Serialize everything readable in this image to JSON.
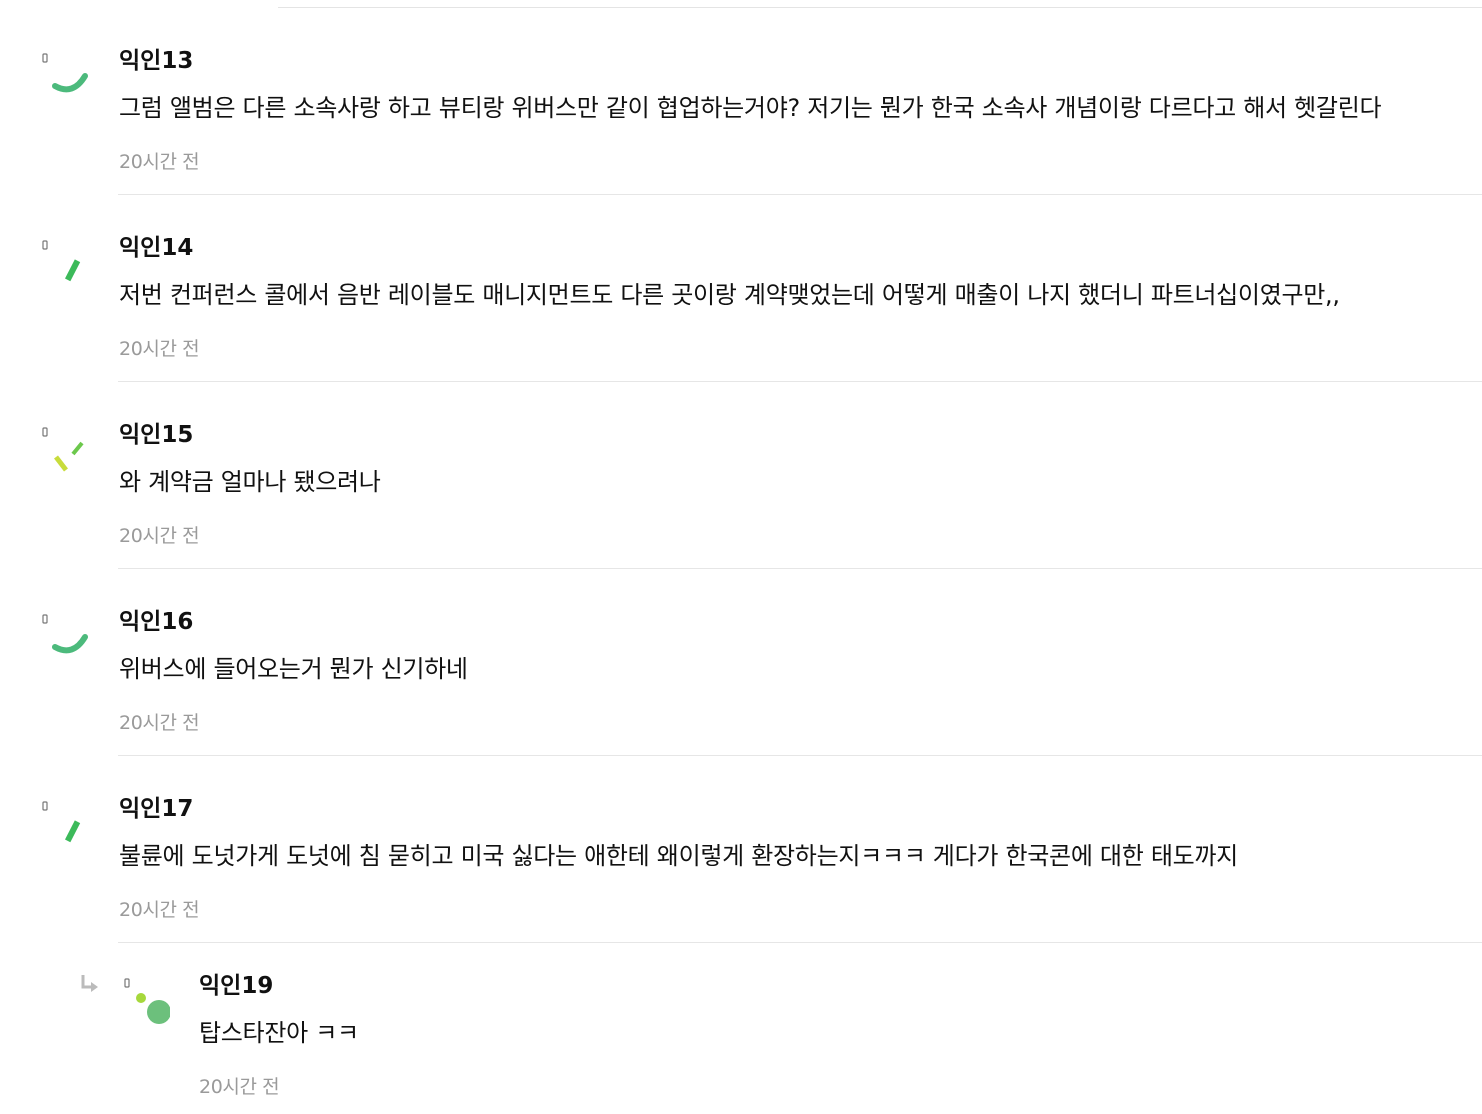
{
  "comments": [
    {
      "author": "익인13",
      "body": "그럼 앨범은 다른 소속사랑 하고 뷰티랑 위버스만 같이 협업하는거야? 저기는 뭔가 한국 소속사 개념이랑 다르다고 해서 헷갈린다",
      "time": "20시간 전",
      "avatar_icon": "arc-avatar-icon",
      "avatar_color": "#4cba7c"
    },
    {
      "author": "익인14",
      "body": "저번 컨퍼런스 콜에서 음반 레이블도 매니지먼트도 다른 곳이랑 계약맺었는데 어떻게 매출이 나지 했더니 파트너십이였구만,,",
      "time": "20시간 전",
      "avatar_icon": "bar-avatar-icon",
      "avatar_color": "#3cba5a"
    },
    {
      "author": "익인15",
      "body": "와 계약금 얼마나 됐으려나",
      "time": "20시간 전",
      "avatar_icon": "dashes-avatar-icon",
      "avatar_color": "#c8dc3c"
    },
    {
      "author": "익인16",
      "body": "위버스에 들어오는거 뭔가 신기하네",
      "time": "20시간 전",
      "avatar_icon": "arc-avatar-icon",
      "avatar_color": "#4cba7c"
    },
    {
      "author": "익인17",
      "body": "불륜에 도넛가게 도넛에 침 묻히고 미국 싫다는 애한테 왜이렇게 환장하는지ㅋㅋㅋ 게다가 한국콘에 대한 태도까지",
      "time": "20시간 전",
      "avatar_icon": "bar-avatar-icon",
      "avatar_color": "#3cba5a"
    }
  ],
  "reply": {
    "author": "익인19",
    "body": "탑스타잔아 ㅋㅋ",
    "time": "20시간 전",
    "reply_icon": "reply-arrow-icon",
    "avatar_icon": "dots-avatar-icon",
    "avatar_color": "#6cc07c",
    "avatar_accent_color": "#a6d83c"
  }
}
